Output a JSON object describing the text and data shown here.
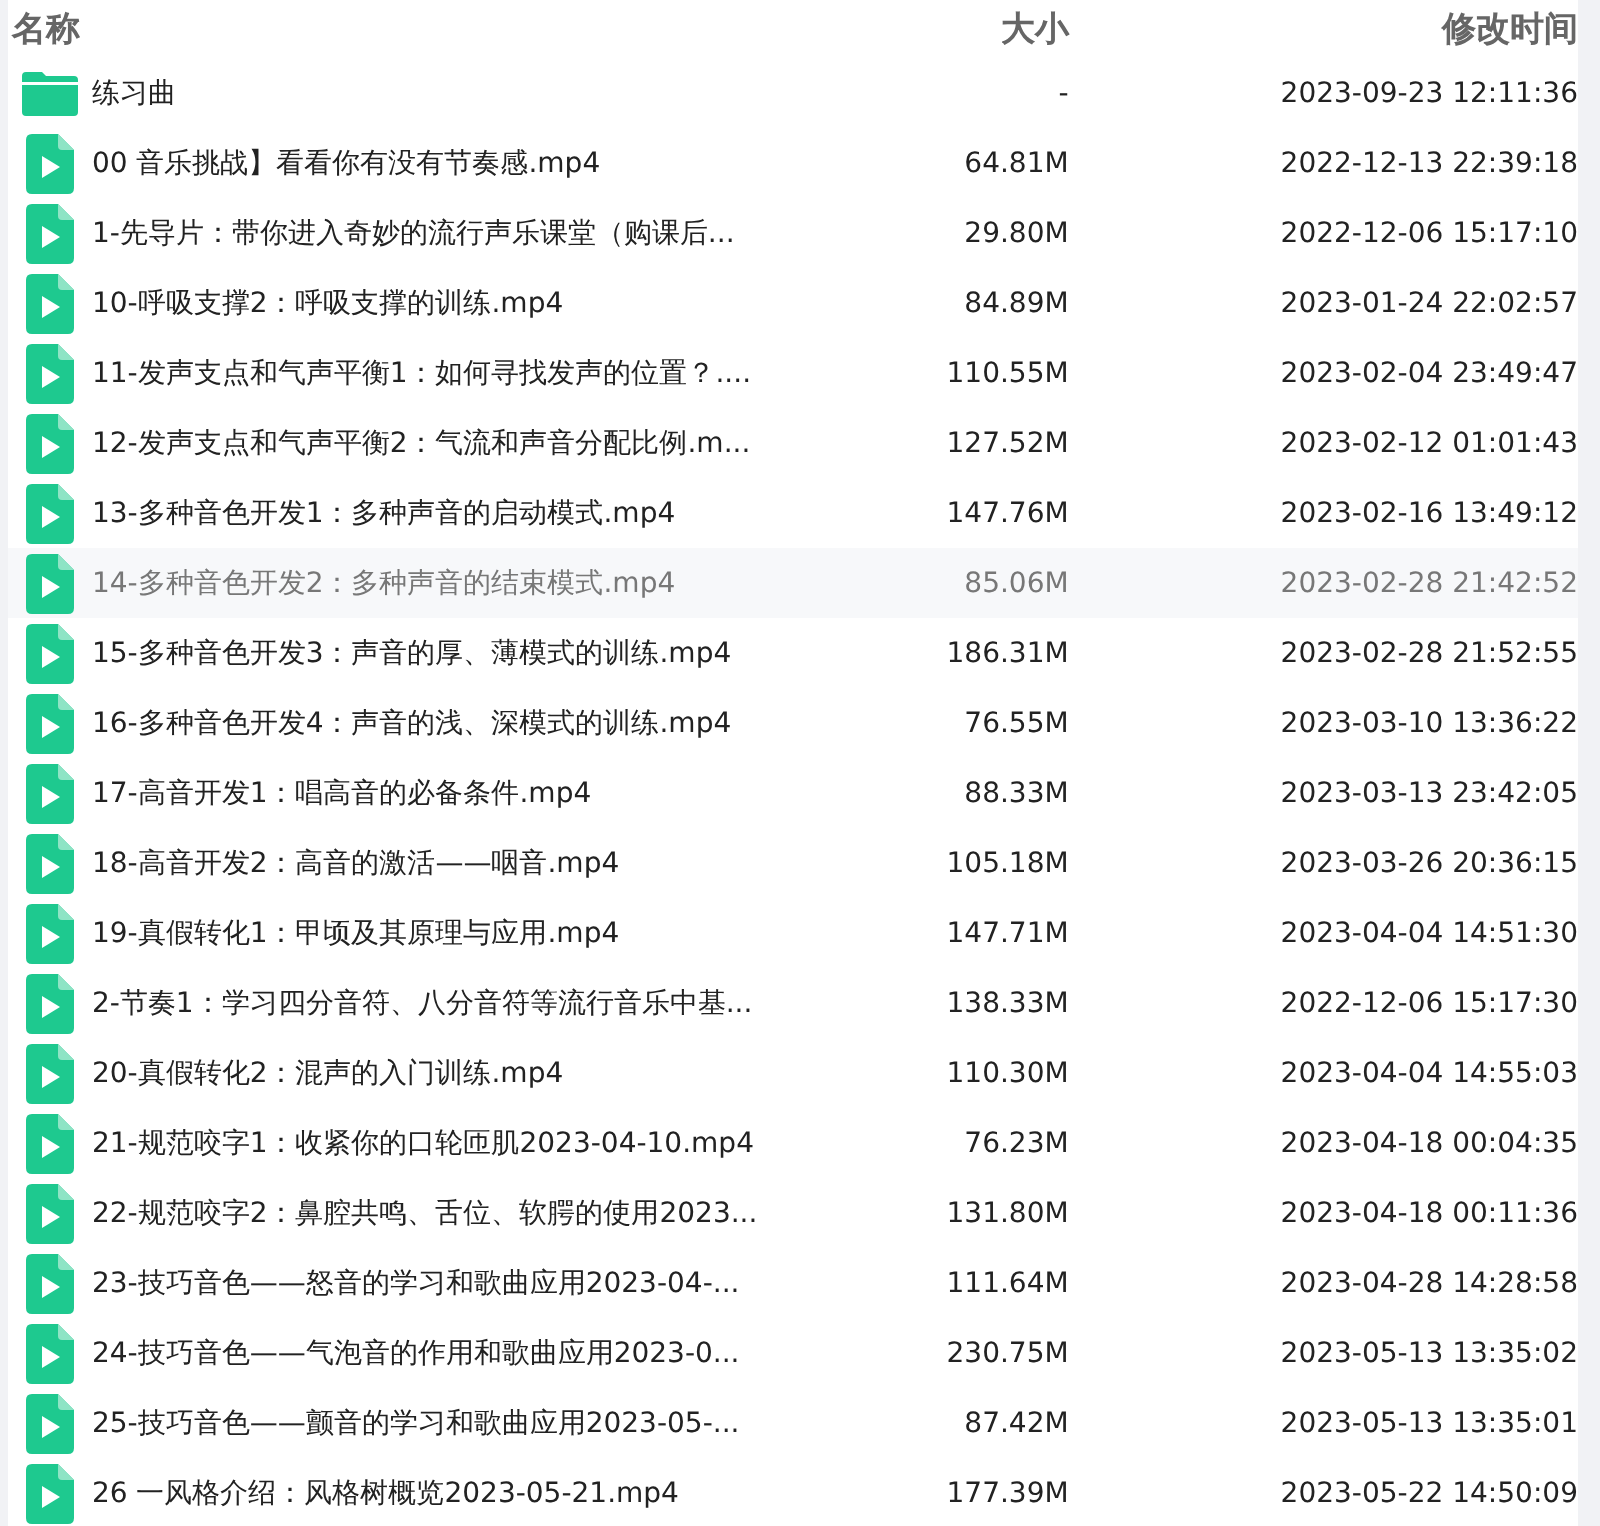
{
  "columns": [
    {
      "label": "名称"
    },
    {
      "label": "大小"
    },
    {
      "label": "修改时间"
    }
  ],
  "rows": [
    {
      "kind": "folder",
      "name": "练习曲",
      "size": "-",
      "modified": "2023-09-23 12:11:36",
      "highlighted": false
    },
    {
      "kind": "video",
      "name": "00 音乐挑战】看看你有没有节奏感.mp4",
      "size": "64.81M",
      "modified": "2022-12-13 22:39:18",
      "highlighted": false
    },
    {
      "kind": "video",
      "name": "1-先导片：带你进入奇妙的流行声乐课堂（购课后...",
      "size": "29.80M",
      "modified": "2022-12-06 15:17:10",
      "highlighted": false
    },
    {
      "kind": "video",
      "name": "10-呼吸支撑2：呼吸支撑的训练.mp4",
      "size": "84.89M",
      "modified": "2023-01-24 22:02:57",
      "highlighted": false
    },
    {
      "kind": "video",
      "name": "11-发声支点和气声平衡1：如何寻找发声的位置？....",
      "size": "110.55M",
      "modified": "2023-02-04 23:49:47",
      "highlighted": false
    },
    {
      "kind": "video",
      "name": "12-发声支点和气声平衡2：气流和声音分配比例.m...",
      "size": "127.52M",
      "modified": "2023-02-12 01:01:43",
      "highlighted": false
    },
    {
      "kind": "video",
      "name": "13-多种音色开发1：多种声音的启动模式.mp4",
      "size": "147.76M",
      "modified": "2023-02-16 13:49:12",
      "highlighted": false
    },
    {
      "kind": "video",
      "name": "14-多种音色开发2：多种声音的结束模式.mp4",
      "size": "85.06M",
      "modified": "2023-02-28 21:42:52",
      "highlighted": true
    },
    {
      "kind": "video",
      "name": "15-多种音色开发3：声音的厚、薄模式的训练.mp4",
      "size": "186.31M",
      "modified": "2023-02-28 21:52:55",
      "highlighted": false
    },
    {
      "kind": "video",
      "name": "16-多种音色开发4：声音的浅、深模式的训练.mp4",
      "size": "76.55M",
      "modified": "2023-03-10 13:36:22",
      "highlighted": false
    },
    {
      "kind": "video",
      "name": "17-高音开发1：唱高音的必备条件.mp4",
      "size": "88.33M",
      "modified": "2023-03-13 23:42:05",
      "highlighted": false
    },
    {
      "kind": "video",
      "name": "18-高音开发2：高音的激活——咽音.mp4",
      "size": "105.18M",
      "modified": "2023-03-26 20:36:15",
      "highlighted": false
    },
    {
      "kind": "video",
      "name": "19-真假转化1：甲顷及其原理与应用.mp4",
      "size": "147.71M",
      "modified": "2023-04-04 14:51:30",
      "highlighted": false
    },
    {
      "kind": "video",
      "name": "2-节奏1：学习四分音符、八分音符等流行音乐中基...",
      "size": "138.33M",
      "modified": "2022-12-06 15:17:30",
      "highlighted": false
    },
    {
      "kind": "video",
      "name": "20-真假转化2：混声的入门训练.mp4",
      "size": "110.30M",
      "modified": "2023-04-04 14:55:03",
      "highlighted": false
    },
    {
      "kind": "video",
      "name": "21-规范咬字1：收紧你的口轮匝肌2023-04-10.mp4",
      "size": "76.23M",
      "modified": "2023-04-18 00:04:35",
      "highlighted": false
    },
    {
      "kind": "video",
      "name": "22-规范咬字2：鼻腔共鸣、舌位、软腭的使用2023...",
      "size": "131.80M",
      "modified": "2023-04-18 00:11:36",
      "highlighted": false
    },
    {
      "kind": "video",
      "name": "23-技巧音色——怒音的学习和歌曲应用2023-04-...",
      "size": "111.64M",
      "modified": "2023-04-28 14:28:58",
      "highlighted": false
    },
    {
      "kind": "video",
      "name": "24-技巧音色——气泡音的作用和歌曲应用2023-0...",
      "size": "230.75M",
      "modified": "2023-05-13 13:35:02",
      "highlighted": false
    },
    {
      "kind": "video",
      "name": "25-技巧音色——颤音的学习和歌曲应用2023-05-...",
      "size": "87.42M",
      "modified": "2023-05-13 13:35:01",
      "highlighted": false
    },
    {
      "kind": "video",
      "name": "26 一风格介绍：风格树概览2023-05-21.mp4",
      "size": "177.39M",
      "modified": "2023-05-22 14:50:09",
      "highlighted": false
    }
  ]
}
